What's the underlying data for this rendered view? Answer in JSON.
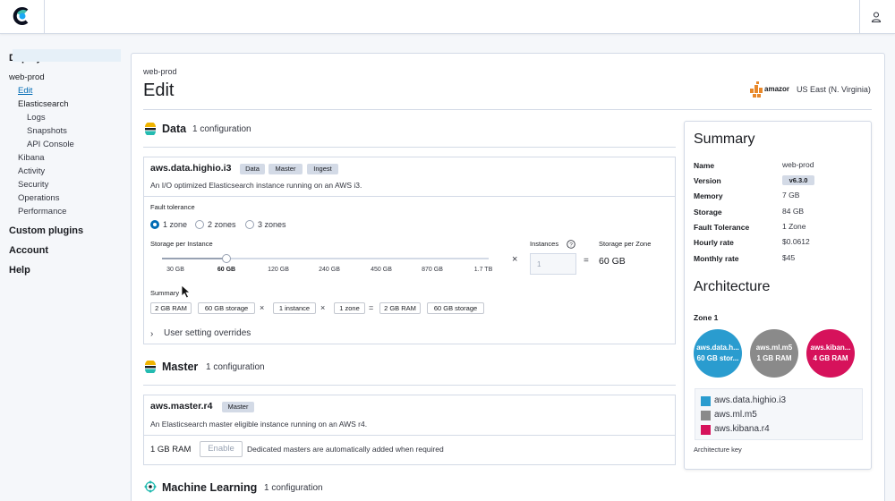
{
  "sidebar": {
    "deployments": "Deployments",
    "deployment_name": "web-prod",
    "items": [
      "Edit",
      "Elasticsearch",
      "Logs",
      "Snapshots",
      "API Console",
      "Kibana",
      "Activity",
      "Security",
      "Operations",
      "Performance"
    ],
    "custom_plugins": "Custom plugins",
    "account": "Account",
    "help": "Help"
  },
  "header": {
    "breadcrumb": "web-prod",
    "title": "Edit",
    "provider_logo_text": "amazon web services",
    "region": "US East (N. Virginia)"
  },
  "data_section": {
    "title": "Data",
    "count": "1 configuration",
    "instance": "aws.data.highio.i3",
    "tags": [
      "Data",
      "Master",
      "Ingest"
    ],
    "description": "An I/O optimized Elasticsearch instance running on an AWS i3.",
    "fault_tolerance_label": "Fault tolerance",
    "zones": [
      "1 zone",
      "2 zones",
      "3 zones"
    ],
    "selected_zone": 0,
    "storage_label": "Storage per Instance",
    "storage_ticks": [
      "30 GB",
      "60 GB",
      "120 GB",
      "240 GB",
      "450 GB",
      "870 GB",
      "1.7 TB"
    ],
    "selected_storage": 1,
    "instances_label": "Instances",
    "instances_placeholder": "1",
    "storage_zone_label": "Storage per Zone",
    "storage_zone_value": "60 GB",
    "summary_label": "Summary",
    "summary_pills": [
      "2 GB RAM",
      "60 GB storage",
      "1 instance",
      "1 zone",
      "2 GB RAM",
      "60 GB storage"
    ],
    "overrides": "User setting overrides"
  },
  "master_section": {
    "title": "Master",
    "count": "1 configuration",
    "instance": "aws.master.r4",
    "tag": "Master",
    "description": "An Elasticsearch master eligible instance running on an AWS r4.",
    "ram": "1 GB RAM",
    "enable": "Enable",
    "note": "Dedicated masters are automatically added when required"
  },
  "ml_section": {
    "title": "Machine Learning",
    "count": "1 configuration"
  },
  "summary": {
    "title": "Summary",
    "rows": [
      {
        "k": "Name",
        "v": "web-prod"
      },
      {
        "k": "Version",
        "v": "v6.3.0"
      },
      {
        "k": "Memory",
        "v": "7 GB"
      },
      {
        "k": "Storage",
        "v": "84 GB"
      },
      {
        "k": "Fault Tolerance",
        "v": "1 Zone"
      },
      {
        "k": "Hourly rate",
        "v": "$0.0612"
      },
      {
        "k": "Monthly rate",
        "v": "$45"
      }
    ]
  },
  "architecture": {
    "title": "Architecture",
    "zone": "Zone 1",
    "nodes": [
      {
        "name": "aws.data.h...",
        "detail": "60 GB stor...",
        "color": "#2a9ccf"
      },
      {
        "name": "aws.ml.m5",
        "detail": "1 GB RAM",
        "color": "#8a8a8a"
      },
      {
        "name": "aws.kiban...",
        "detail": "4 GB RAM",
        "color": "#d6125b"
      }
    ],
    "legend": [
      {
        "label": "aws.data.highio.i3",
        "color": "#2a9ccf"
      },
      {
        "label": "aws.ml.m5",
        "color": "#8a8a8a"
      },
      {
        "label": "aws.kibana.r4",
        "color": "#d6125b"
      }
    ],
    "key_label": "Architecture key"
  }
}
